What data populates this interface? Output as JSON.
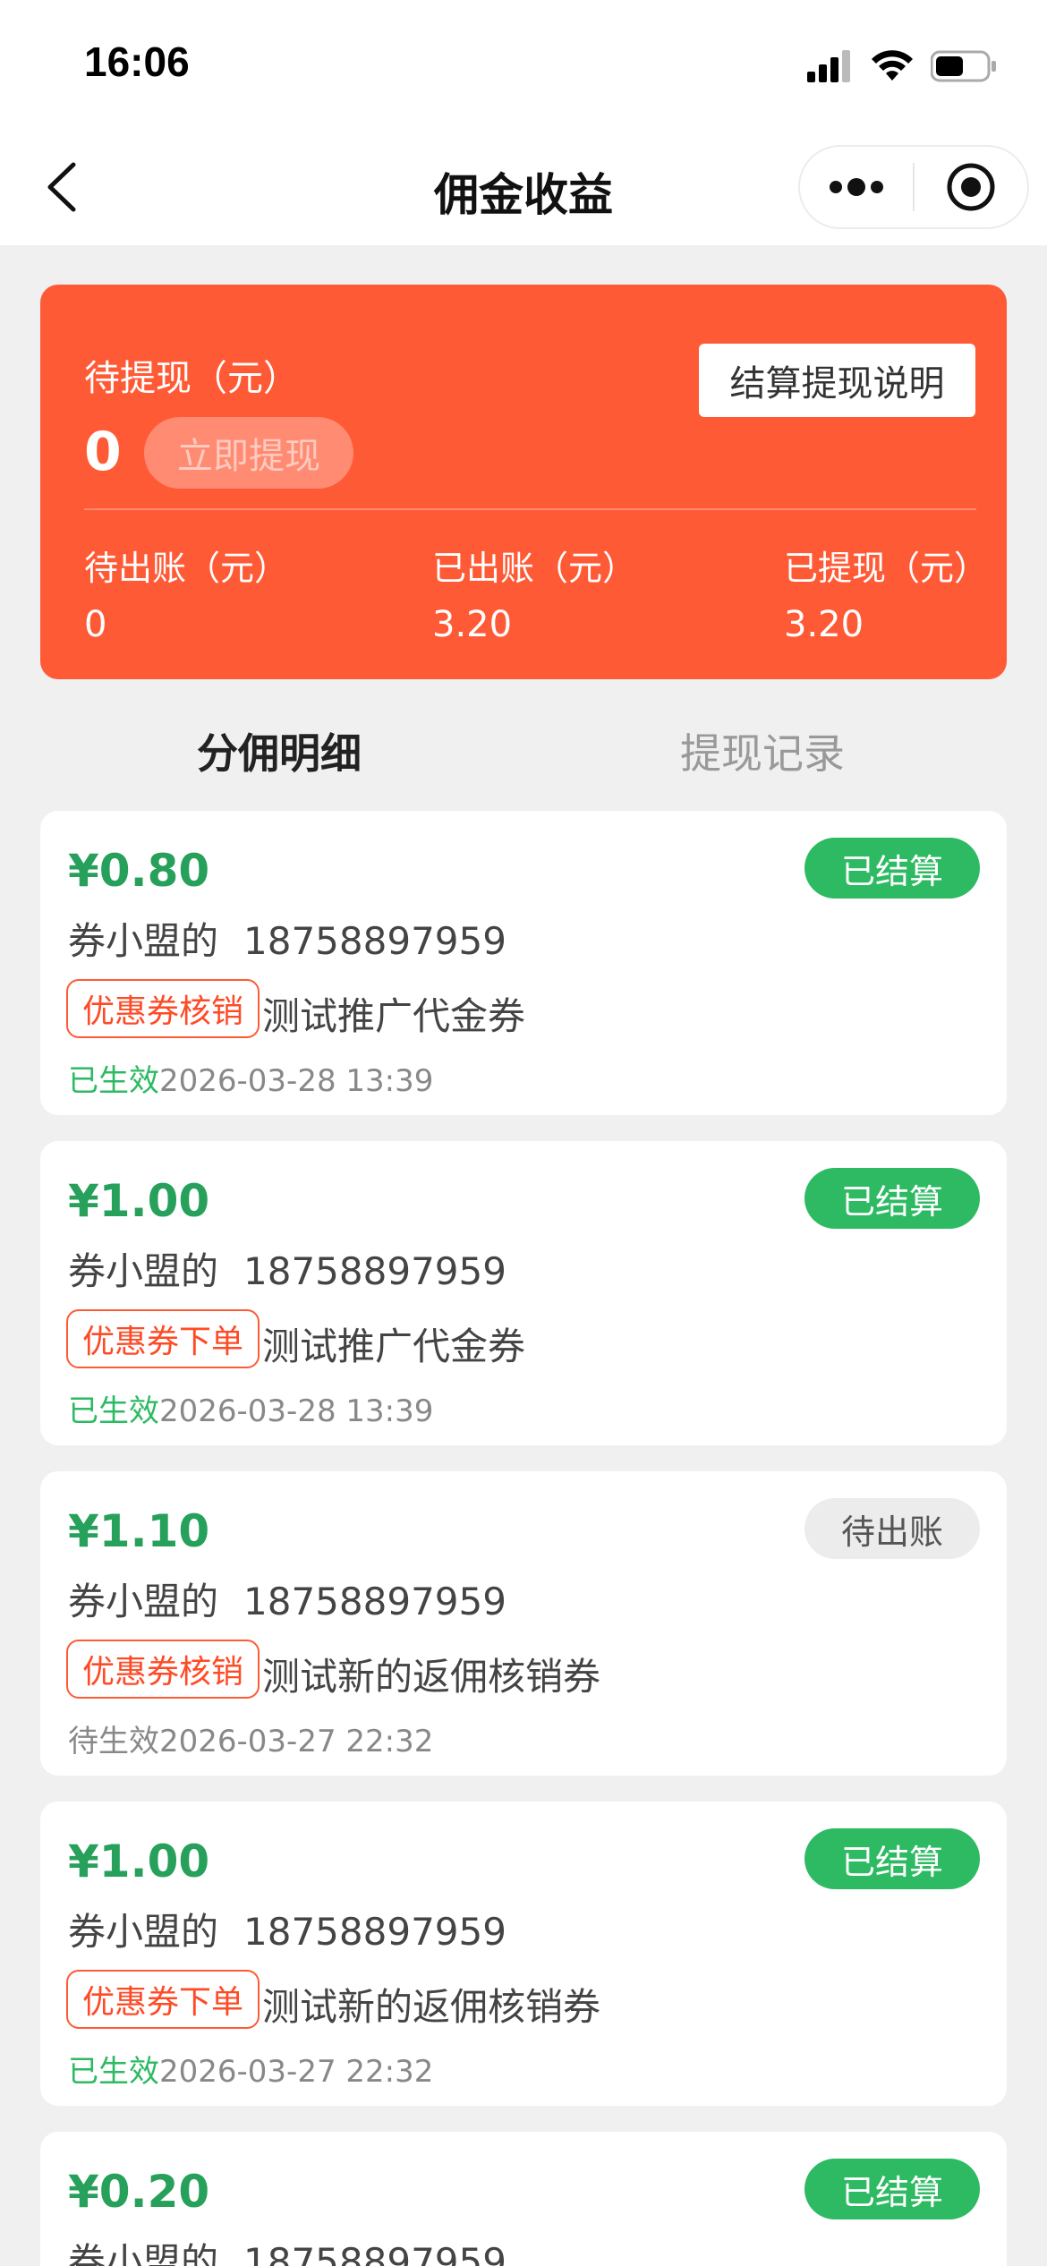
{
  "status_bar": {
    "time": "16:06"
  },
  "nav": {
    "title": "佣金收益"
  },
  "balance": {
    "label": "待提现（元）",
    "amount": "0",
    "withdraw_label": "立即提现",
    "explain_label": "结算提现说明",
    "stats": [
      {
        "label": "待出账（元）",
        "value": "0"
      },
      {
        "label": "已出账（元）",
        "value": "3.20"
      },
      {
        "label": "已提现（元）",
        "value": "3.20"
      }
    ]
  },
  "tabs": [
    {
      "label": "分佣明细",
      "active": true
    },
    {
      "label": "提现记录",
      "active": false
    }
  ],
  "records": [
    {
      "amount": "¥0.80",
      "status": "已结算",
      "user": "券小盟的",
      "phone": "18758897959",
      "tag": "优惠券核销",
      "coupon": "测试推广代金券",
      "effect": "已生效",
      "time": "2026-03-28 13:39"
    },
    {
      "amount": "¥1.00",
      "status": "已结算",
      "user": "券小盟的",
      "phone": "18758897959",
      "tag": "优惠券下单",
      "coupon": "测试推广代金券",
      "effect": "已生效",
      "time": "2026-03-28 13:39"
    },
    {
      "amount": "¥1.10",
      "status": "待出账",
      "user": "券小盟的",
      "phone": "18758897959",
      "tag": "优惠券核销",
      "coupon": "测试新的返佣核销券",
      "effect": "待生效",
      "time": "2026-03-27 22:32"
    },
    {
      "amount": "¥1.00",
      "status": "已结算",
      "user": "券小盟的",
      "phone": "18758897959",
      "tag": "优惠券下单",
      "coupon": "测试新的返佣核销券",
      "effect": "已生效",
      "time": "2026-03-27 22:32"
    },
    {
      "amount": "¥0.20",
      "status": "已结算",
      "user": "券小盟的",
      "phone": "18758897959",
      "tag": "",
      "coupon": "",
      "effect": "",
      "time": ""
    }
  ]
}
